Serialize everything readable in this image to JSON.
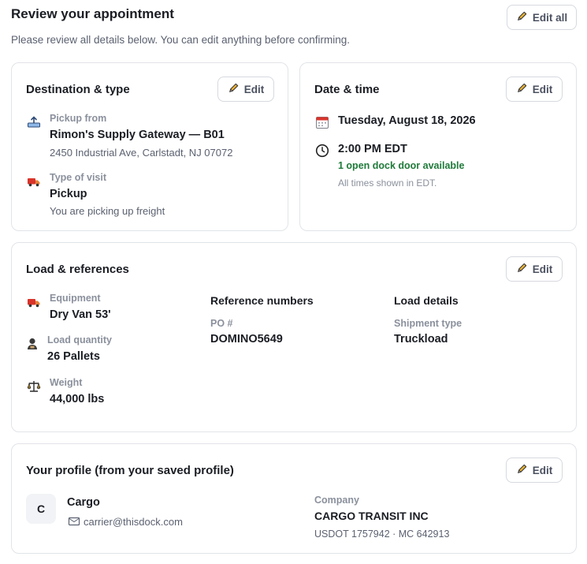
{
  "header": {
    "title": "Review your appointment",
    "subtitle": "Please review all details below. You can edit anything before confirming.",
    "edit_all_label": "Edit all"
  },
  "destination": {
    "title": "Destination & type",
    "edit_label": "Edit",
    "pickup_label": "Pickup from",
    "pickup_name": "Rimon's Supply Gateway — B01",
    "pickup_address": "2450 Industrial Ave, Carlstadt, NJ 07072",
    "visit_label": "Type of visit",
    "visit_value": "Pickup",
    "visit_desc": "You are picking up freight"
  },
  "datetime": {
    "title": "Date & time",
    "edit_label": "Edit",
    "date": "Tuesday, August 18, 2026",
    "time": "2:00 PM EDT",
    "availability": "1 open dock door available",
    "tz_note": "All times shown in EDT."
  },
  "load": {
    "title": "Load & references",
    "edit_label": "Edit",
    "equipment_label": "Equipment",
    "equipment_value": "Dry Van 53'",
    "quantity_label": "Load quantity",
    "quantity_value": "26 Pallets",
    "weight_label": "Weight",
    "weight_value": "44,000 lbs",
    "refs_heading": "Reference numbers",
    "po_label": "PO #",
    "po_value": "DOMINO5649",
    "details_heading": "Load details",
    "shipment_label": "Shipment type",
    "shipment_value": "Truckload"
  },
  "profile": {
    "title": "Your profile (from your saved profile)",
    "edit_label": "Edit",
    "avatar_initial": "C",
    "name": "Cargo",
    "email": "carrier@thisdock.com",
    "company_label": "Company",
    "company_name": "CARGO TRANSIT INC",
    "company_ids": "USDOT 1757942 · MC 642913"
  },
  "icons": {
    "edit": "pencil-icon",
    "pickup": "pickup-tray-icon",
    "truck": "truck-icon",
    "calendar": "calendar-icon",
    "clock": "clock-icon",
    "quantity": "pallet-person-icon",
    "weight": "scale-icon",
    "email": "envelope-icon"
  },
  "colors": {
    "accent_green": "#1f7a3a",
    "pencil_yellow": "#f2b531",
    "truck_red": "#d9342b"
  }
}
